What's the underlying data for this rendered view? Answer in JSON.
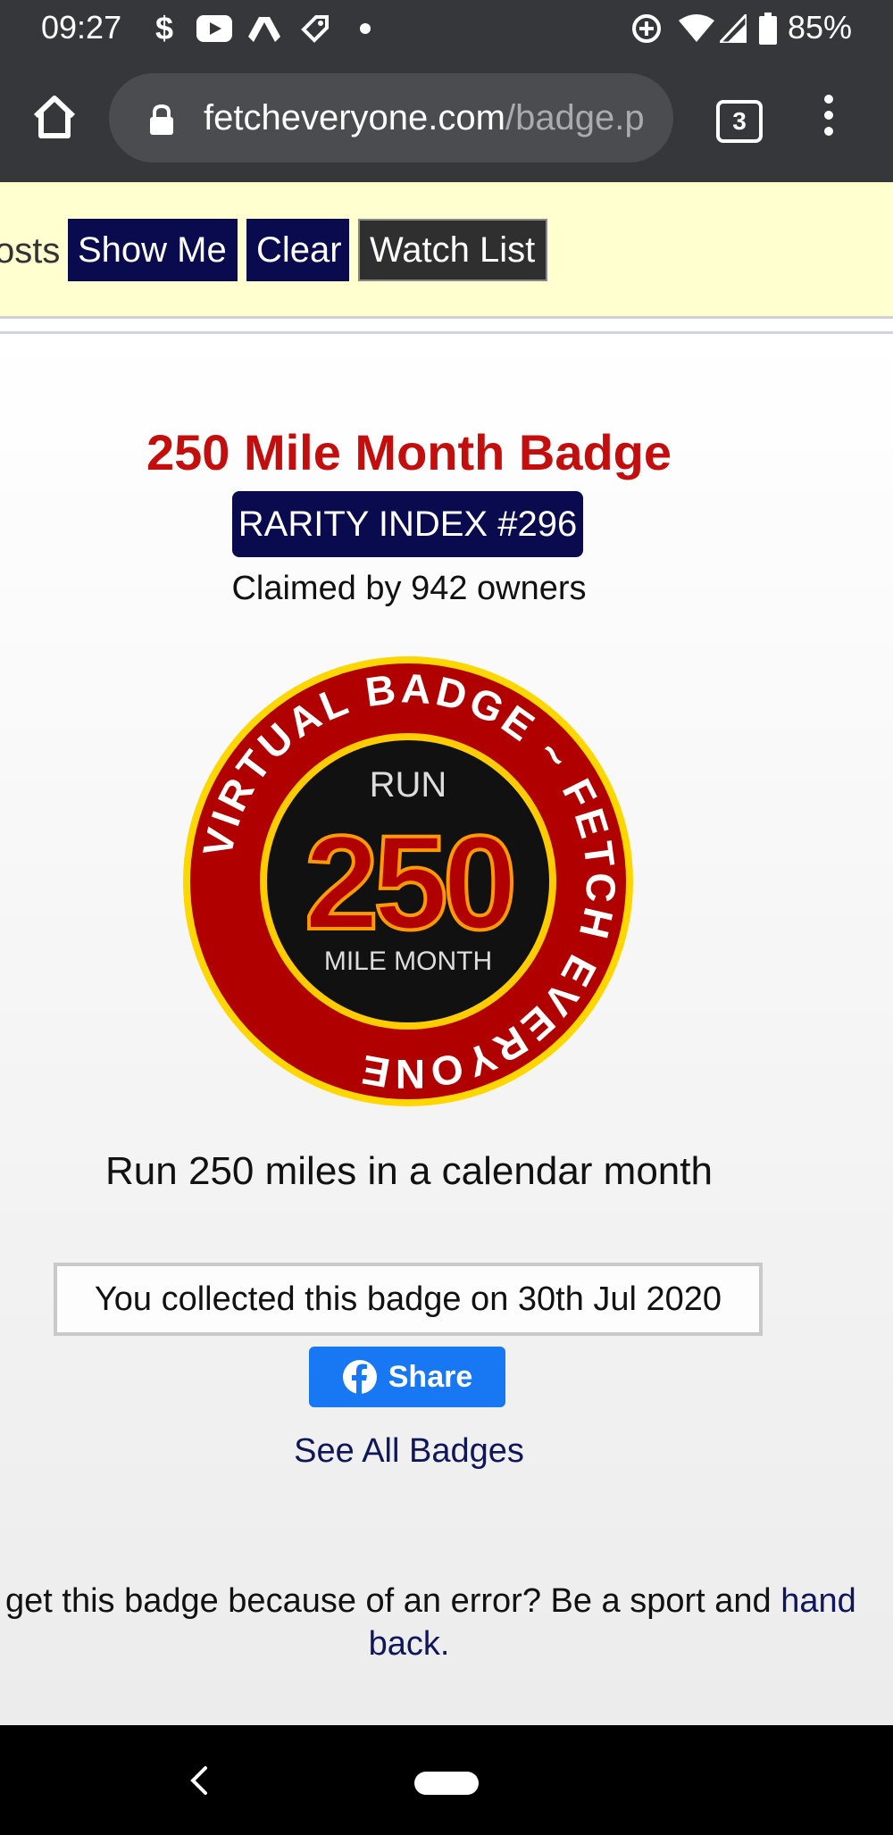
{
  "status_bar": {
    "time": "09:27",
    "battery": "85%",
    "icons": [
      "dollar-icon",
      "youtube-icon",
      "drive-icon",
      "tag-icon",
      "dot-icon",
      "data-saver-icon",
      "wifi-icon",
      "signal-icon",
      "battery-icon"
    ]
  },
  "browser": {
    "url_domain": "fetcheveryone.com",
    "url_path": "/badge.p",
    "tab_count": "3"
  },
  "toolbar": {
    "posts_text": "osts",
    "show_me_label": "Show Me",
    "clear_label": "Clear",
    "watch_list_label": "Watch List"
  },
  "badge": {
    "title": "250 Mile Month Badge",
    "rarity": "RARITY INDEX #296",
    "claimed": "Claimed by 942 owners",
    "image": {
      "ring_text": "VIRTUAL BADGE ~ FETCH EVERYONE",
      "top": "RUN",
      "number": "250",
      "bottom": "MILE MONTH"
    },
    "description": "Run 250 miles in a calendar month",
    "collected": "You collected this badge on 30th Jul 2020",
    "share_label": "Share",
    "see_all": "See All Badges",
    "error_text": "get this badge because of an error? Be a sport and ",
    "error_link_part": "hand",
    "error_link_back": "back",
    "error_end": "."
  },
  "colors": {
    "title_red": "#c40d0d",
    "navy": "#0a0b4f",
    "facebook_blue": "#1877f2",
    "toolbar_bg": "#ffffcf"
  }
}
